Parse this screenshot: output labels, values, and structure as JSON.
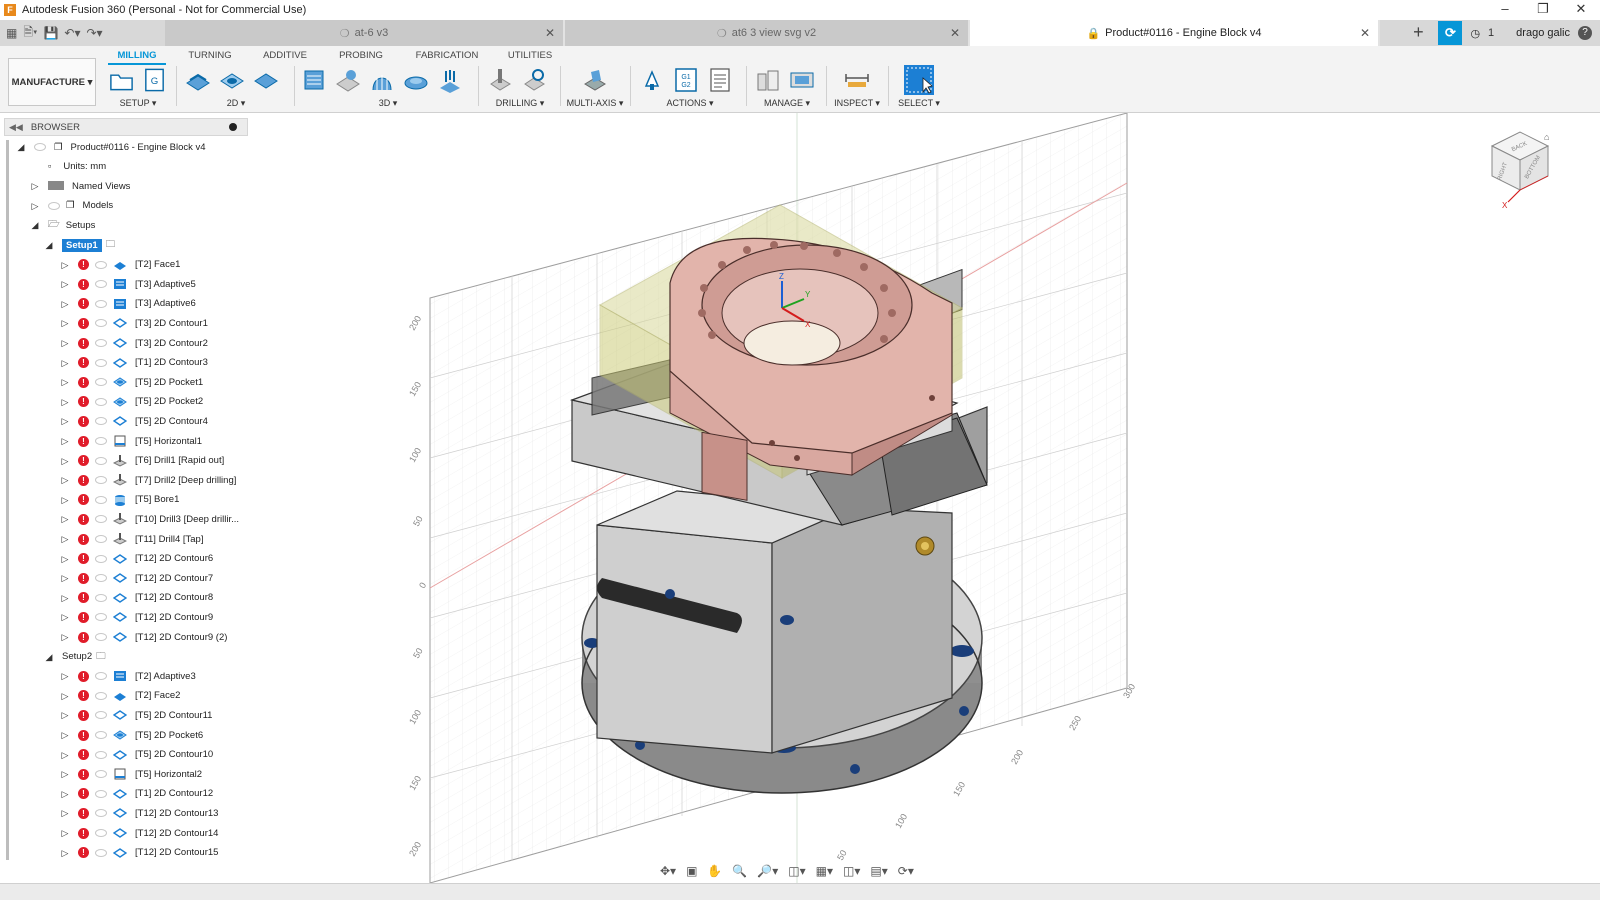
{
  "window": {
    "title": "Autodesk Fusion 360 (Personal - Not for Commercial Use)",
    "app_icon": "F"
  },
  "tabs": [
    {
      "label": "at-6 v3",
      "active": false
    },
    {
      "label": "at6 3 view svg v2",
      "active": false
    },
    {
      "label": "Product#0116 - Engine Block v4",
      "active": true
    }
  ],
  "header_right": {
    "notification_count": "1",
    "user_name": "drago galic"
  },
  "ribbon": {
    "workspace": "MANUFACTURE ▾",
    "tabs": [
      "MILLING",
      "TURNING",
      "ADDITIVE",
      "PROBING",
      "FABRICATION",
      "UTILITIES"
    ],
    "active_tab": "MILLING",
    "groups": [
      "SETUP ▾",
      "2D ▾",
      "3D ▾",
      "DRILLING ▾",
      "MULTI-AXIS ▾",
      "ACTIONS ▾",
      "MANAGE ▾",
      "INSPECT ▾",
      "SELECT ▾"
    ]
  },
  "browser": {
    "header": "BROWSER",
    "root": "Product#0116 - Engine Block v4",
    "units": "Units: mm",
    "named_views": "Named Views",
    "models": "Models",
    "setups": "Setups",
    "setup1": {
      "label": "Setup1",
      "ops": [
        {
          "label": "[T2] Face1",
          "icon": "face"
        },
        {
          "label": "[T3] Adaptive5",
          "icon": "adaptive"
        },
        {
          "label": "[T3] Adaptive6",
          "icon": "adaptive"
        },
        {
          "label": "[T3] 2D Contour1",
          "icon": "contour"
        },
        {
          "label": "[T3] 2D Contour2",
          "icon": "contour"
        },
        {
          "label": "[T1] 2D Contour3",
          "icon": "contour"
        },
        {
          "label": "[T5] 2D Pocket1",
          "icon": "pocket"
        },
        {
          "label": "[T5] 2D Pocket2",
          "icon": "pocket"
        },
        {
          "label": "[T5] 2D Contour4",
          "icon": "contour"
        },
        {
          "label": "[T5] Horizontal1",
          "icon": "horizontal"
        },
        {
          "label": "[T6] Drill1 [Rapid out]",
          "icon": "drill"
        },
        {
          "label": "[T7] Drill2 [Deep drilling]",
          "icon": "drill"
        },
        {
          "label": "[T5] Bore1",
          "icon": "bore"
        },
        {
          "label": "[T10] Drill3 [Deep drillir...",
          "icon": "drill"
        },
        {
          "label": "[T11] Drill4 [Tap]",
          "icon": "drill"
        },
        {
          "label": "[T12] 2D Contour6",
          "icon": "contour"
        },
        {
          "label": "[T12] 2D Contour7",
          "icon": "contour"
        },
        {
          "label": "[T12] 2D Contour8",
          "icon": "contour"
        },
        {
          "label": "[T12] 2D Contour9",
          "icon": "contour"
        },
        {
          "label": "[T12] 2D Contour9 (2)",
          "icon": "contour"
        }
      ]
    },
    "setup2": {
      "label": "Setup2",
      "ops": [
        {
          "label": "[T2] Adaptive3",
          "icon": "adaptive"
        },
        {
          "label": "[T2] Face2",
          "icon": "face"
        },
        {
          "label": "[T5] 2D Contour11",
          "icon": "contour"
        },
        {
          "label": "[T5] 2D Pocket6",
          "icon": "pocket"
        },
        {
          "label": "[T5] 2D Contour10",
          "icon": "contour"
        },
        {
          "label": "[T5] Horizontal2",
          "icon": "horizontal"
        },
        {
          "label": "[T1] 2D Contour12",
          "icon": "contour"
        },
        {
          "label": "[T12] 2D Contour13",
          "icon": "contour"
        },
        {
          "label": "[T12] 2D Contour14",
          "icon": "contour"
        },
        {
          "label": "[T12] 2D Contour15",
          "icon": "contour"
        }
      ]
    }
  },
  "grid_labels": {
    "left": [
      "200",
      "150",
      "100",
      "50",
      "0",
      "50",
      "100",
      "150",
      "200"
    ],
    "bottom": [
      "50",
      "100",
      "150",
      "200",
      "250",
      "300"
    ]
  },
  "viewcube": {
    "faces": [
      "BACK",
      "RIGHT",
      "BOTTOM"
    ],
    "axis": "X"
  },
  "triad": {
    "z": "Z",
    "y": "Y",
    "x": "X"
  },
  "colors": {
    "accent": "#0696d7",
    "error": "#e01c2a",
    "part": "#d9a8a0",
    "stock": "#c8c88a",
    "vise": "#9a9a9a"
  }
}
